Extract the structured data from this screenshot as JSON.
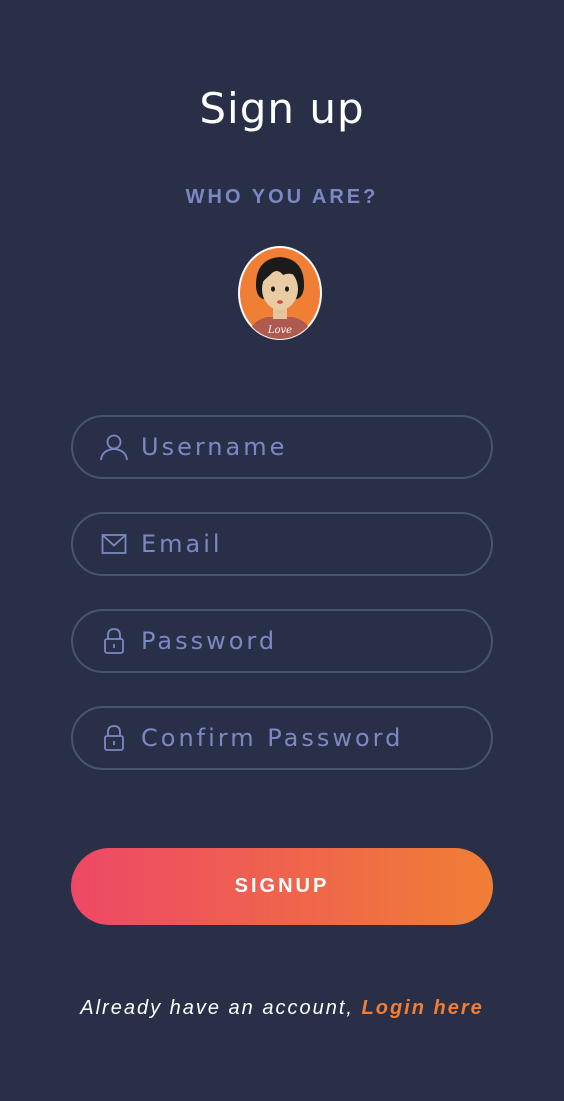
{
  "page": {
    "title": "Sign up",
    "subtitle": "WHO YOU ARE?"
  },
  "avatar": {
    "shirt_text": "Love",
    "icon": "avatar-icon"
  },
  "form": {
    "username": {
      "placeholder": "Username",
      "value": "",
      "icon": "user-icon"
    },
    "email": {
      "placeholder": "Email",
      "value": "",
      "icon": "envelope-icon"
    },
    "password": {
      "placeholder": "Password",
      "value": "",
      "icon": "lock-icon"
    },
    "confirm_password": {
      "placeholder": "Confirm Password",
      "value": "",
      "icon": "lock-icon"
    }
  },
  "signup_button": {
    "label": "SIGNUP"
  },
  "footer": {
    "text": "Already have an account,",
    "link_label": "Login here"
  },
  "colors": {
    "background": "#2a2f48",
    "accent": "#7b88c4",
    "gradient_start": "#ee4866",
    "gradient_end": "#f07e35",
    "link": "#f07e35"
  }
}
